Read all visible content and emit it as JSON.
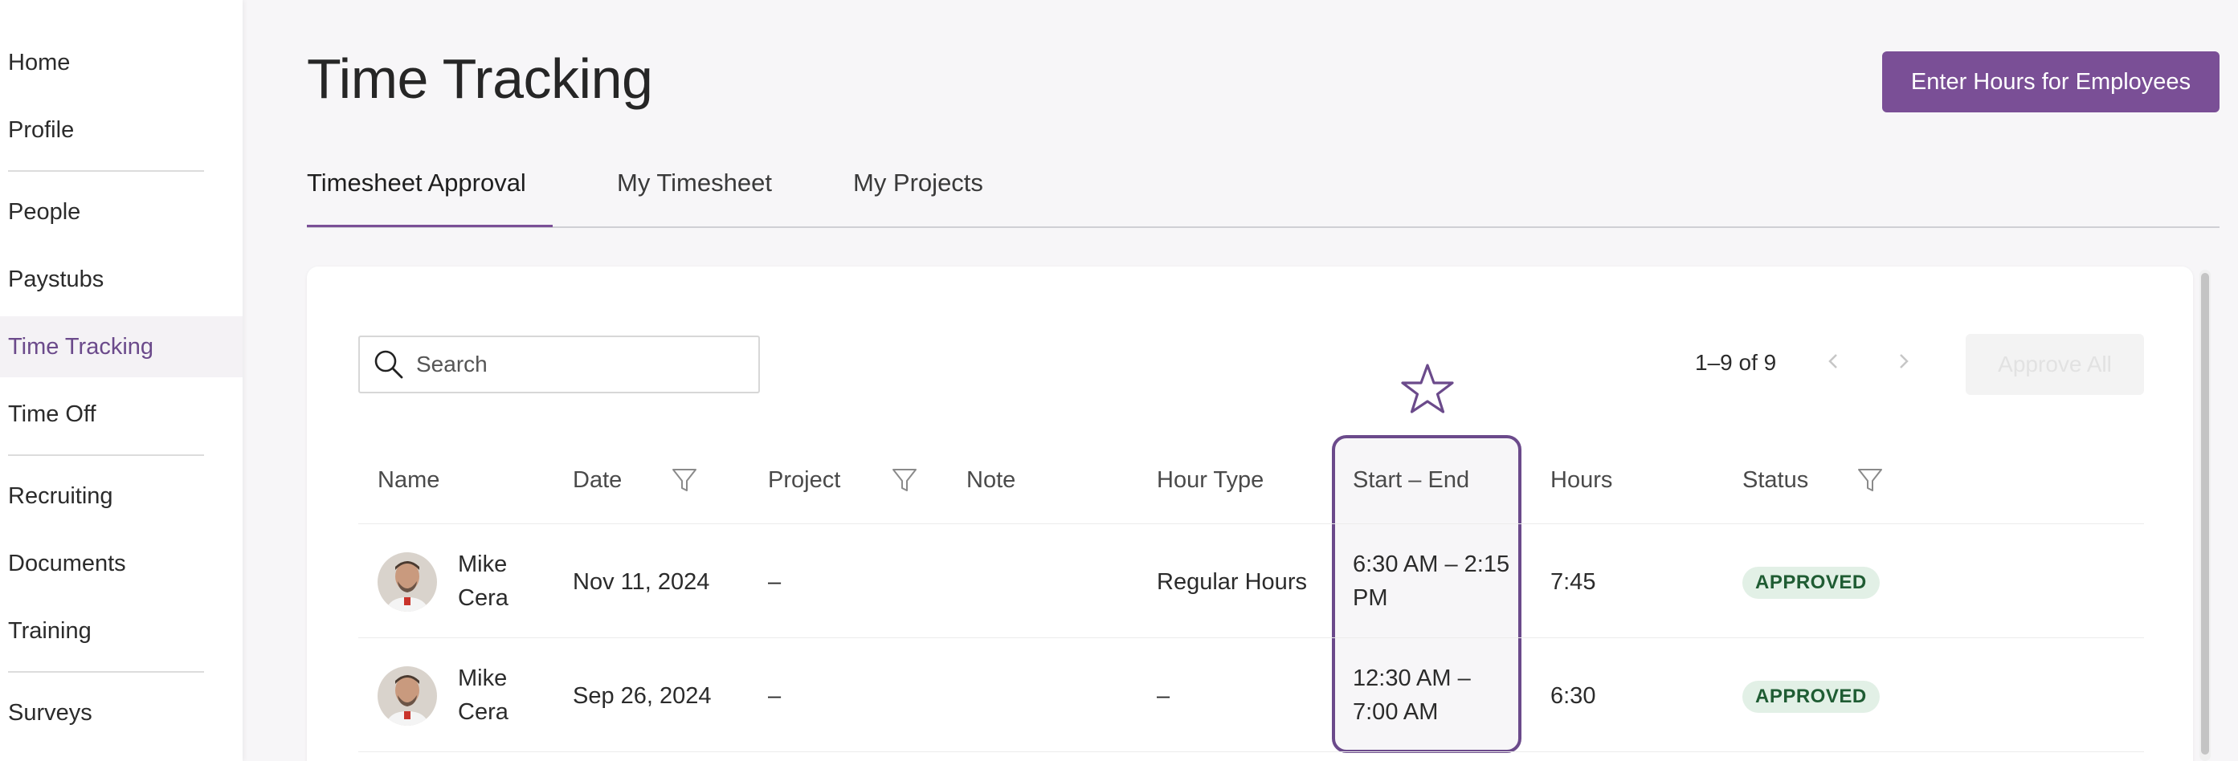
{
  "sidebar": {
    "items": [
      {
        "label": "Home"
      },
      {
        "label": "Profile"
      },
      {
        "label": "People"
      },
      {
        "label": "Paystubs"
      },
      {
        "label": "Time Tracking"
      },
      {
        "label": "Time Off"
      },
      {
        "label": "Recruiting"
      },
      {
        "label": "Documents"
      },
      {
        "label": "Training"
      },
      {
        "label": "Surveys"
      }
    ],
    "active": "Time Tracking"
  },
  "header": {
    "title": "Time Tracking",
    "primary_button": "Enter Hours for Employees"
  },
  "tabs": [
    {
      "label": "Timesheet Approval",
      "active": true
    },
    {
      "label": "My Timesheet",
      "active": false
    },
    {
      "label": "My Projects",
      "active": false
    }
  ],
  "toolbar": {
    "search_placeholder": "Search",
    "pagination": "1–9 of 9",
    "approve_all_label": "Approve All"
  },
  "table": {
    "columns": [
      "Name",
      "Date",
      "Project",
      "Note",
      "Hour Type",
      "Start – End",
      "Hours",
      "Status"
    ],
    "rows": [
      {
        "name_first": "Mike",
        "name_last": "Cera",
        "date": "Nov 11, 2024",
        "project": "–",
        "note": "",
        "hour_type": "Regular Hours",
        "start_end_1": "6:30 AM – 2:15",
        "start_end_2": "PM",
        "hours": "7:45",
        "status": "APPROVED"
      },
      {
        "name_first": "Mike",
        "name_last": "Cera",
        "date": "Sep 26, 2024",
        "project": "–",
        "note": "",
        "hour_type": "–",
        "start_end_1": "12:30 AM –",
        "start_end_2": "7:00 AM",
        "hours": "6:30",
        "status": "APPROVED"
      }
    ]
  },
  "colors": {
    "accent": "#7a4f96",
    "approved_bg": "#e2f0e6",
    "approved_text": "#1f5c33"
  }
}
